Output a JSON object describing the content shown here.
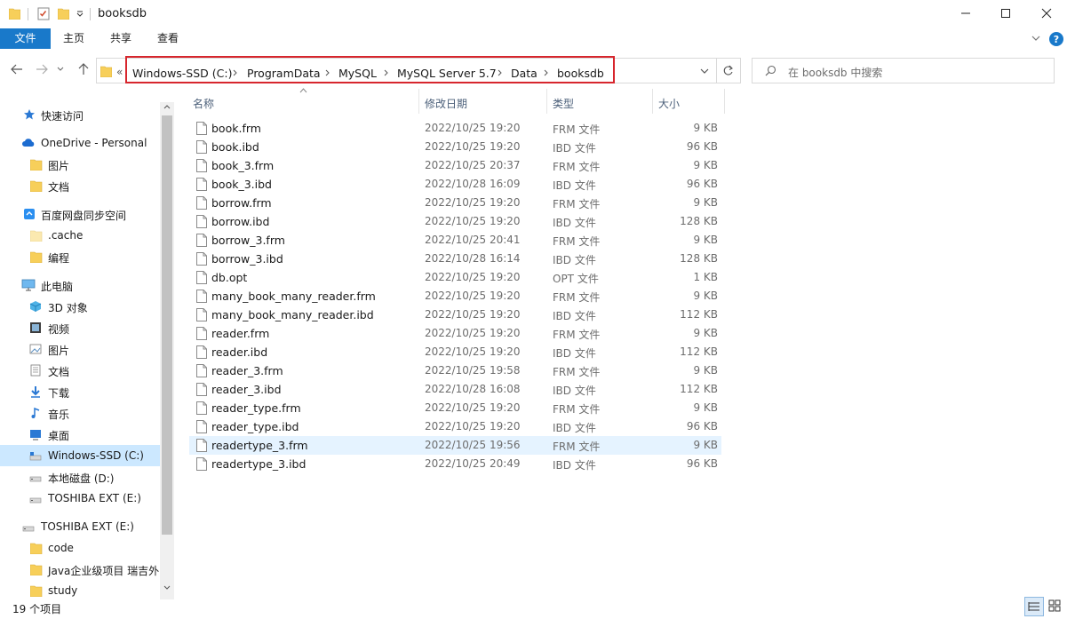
{
  "window": {
    "title": "booksdb"
  },
  "ribbon": {
    "tabs": [
      {
        "label": "文件"
      },
      {
        "label": "主页"
      },
      {
        "label": "共享"
      },
      {
        "label": "查看"
      }
    ]
  },
  "address": {
    "overflow": "«",
    "crumbs": [
      "Windows-SSD (C:)",
      "ProgramData",
      "MySQL",
      "MySQL Server 5.7",
      "Data",
      "booksdb"
    ]
  },
  "search": {
    "placeholder": "在 booksdb 中搜索"
  },
  "sidebar": {
    "items": [
      {
        "label": "快速访问",
        "icon": "star-icon"
      },
      {
        "label": "OneDrive - Personal",
        "icon": "cloud-icon"
      },
      {
        "label": "图片",
        "icon": "folder-icon"
      },
      {
        "label": "文档",
        "icon": "folder-icon"
      },
      {
        "label": "百度网盘同步空间",
        "icon": "baidu-sync-icon"
      },
      {
        "label": ".cache",
        "icon": "folder-icon"
      },
      {
        "label": "编程",
        "icon": "folder-icon"
      },
      {
        "label": "此电脑",
        "icon": "computer-icon"
      },
      {
        "label": "3D 对象",
        "icon": "cube-icon"
      },
      {
        "label": "视频",
        "icon": "video-icon"
      },
      {
        "label": "图片",
        "icon": "pictures-icon"
      },
      {
        "label": "文档",
        "icon": "documents-icon"
      },
      {
        "label": "下载",
        "icon": "download-icon"
      },
      {
        "label": "音乐",
        "icon": "music-icon"
      },
      {
        "label": "桌面",
        "icon": "desktop-icon"
      },
      {
        "label": "Windows-SSD (C:)",
        "icon": "drive-icon"
      },
      {
        "label": "本地磁盘 (D:)",
        "icon": "drive-icon"
      },
      {
        "label": "TOSHIBA EXT (E:)",
        "icon": "drive-icon"
      },
      {
        "label": "TOSHIBA EXT (E:)",
        "icon": "drive-icon"
      },
      {
        "label": "code",
        "icon": "folder-icon"
      },
      {
        "label": "Java企业级项目 瑞吉外",
        "icon": "folder-icon"
      },
      {
        "label": "study",
        "icon": "folder-icon"
      }
    ]
  },
  "columns": {
    "name": "名称",
    "date": "修改日期",
    "type": "类型",
    "size": "大小"
  },
  "files": [
    {
      "name": "book.frm",
      "date": "2022/10/25 19:20",
      "type": "FRM 文件",
      "size": "9 KB"
    },
    {
      "name": "book.ibd",
      "date": "2022/10/25 19:20",
      "type": "IBD 文件",
      "size": "96 KB"
    },
    {
      "name": "book_3.frm",
      "date": "2022/10/25 20:37",
      "type": "FRM 文件",
      "size": "9 KB"
    },
    {
      "name": "book_3.ibd",
      "date": "2022/10/28 16:09",
      "type": "IBD 文件",
      "size": "96 KB"
    },
    {
      "name": "borrow.frm",
      "date": "2022/10/25 19:20",
      "type": "FRM 文件",
      "size": "9 KB"
    },
    {
      "name": "borrow.ibd",
      "date": "2022/10/25 19:20",
      "type": "IBD 文件",
      "size": "128 KB"
    },
    {
      "name": "borrow_3.frm",
      "date": "2022/10/25 20:41",
      "type": "FRM 文件",
      "size": "9 KB"
    },
    {
      "name": "borrow_3.ibd",
      "date": "2022/10/28 16:14",
      "type": "IBD 文件",
      "size": "128 KB"
    },
    {
      "name": "db.opt",
      "date": "2022/10/25 19:20",
      "type": "OPT 文件",
      "size": "1 KB"
    },
    {
      "name": "many_book_many_reader.frm",
      "date": "2022/10/25 19:20",
      "type": "FRM 文件",
      "size": "9 KB"
    },
    {
      "name": "many_book_many_reader.ibd",
      "date": "2022/10/25 19:20",
      "type": "IBD 文件",
      "size": "112 KB"
    },
    {
      "name": "reader.frm",
      "date": "2022/10/25 19:20",
      "type": "FRM 文件",
      "size": "9 KB"
    },
    {
      "name": "reader.ibd",
      "date": "2022/10/25 19:20",
      "type": "IBD 文件",
      "size": "112 KB"
    },
    {
      "name": "reader_3.frm",
      "date": "2022/10/25 19:58",
      "type": "FRM 文件",
      "size": "9 KB"
    },
    {
      "name": "reader_3.ibd",
      "date": "2022/10/28 16:08",
      "type": "IBD 文件",
      "size": "112 KB"
    },
    {
      "name": "reader_type.frm",
      "date": "2022/10/25 19:20",
      "type": "FRM 文件",
      "size": "9 KB"
    },
    {
      "name": "reader_type.ibd",
      "date": "2022/10/25 19:20",
      "type": "IBD 文件",
      "size": "96 KB"
    },
    {
      "name": "readertype_3.frm",
      "date": "2022/10/25 19:56",
      "type": "FRM 文件",
      "size": "9 KB"
    },
    {
      "name": "readertype_3.ibd",
      "date": "2022/10/25 20:49",
      "type": "IBD 文件",
      "size": "96 KB"
    }
  ],
  "status": {
    "count": "19 个项目"
  },
  "colors": {
    "accent": "#1979ca",
    "selection": "#cce8ff",
    "hover": "#e5f3ff",
    "highlight_box": "#d7262d"
  }
}
